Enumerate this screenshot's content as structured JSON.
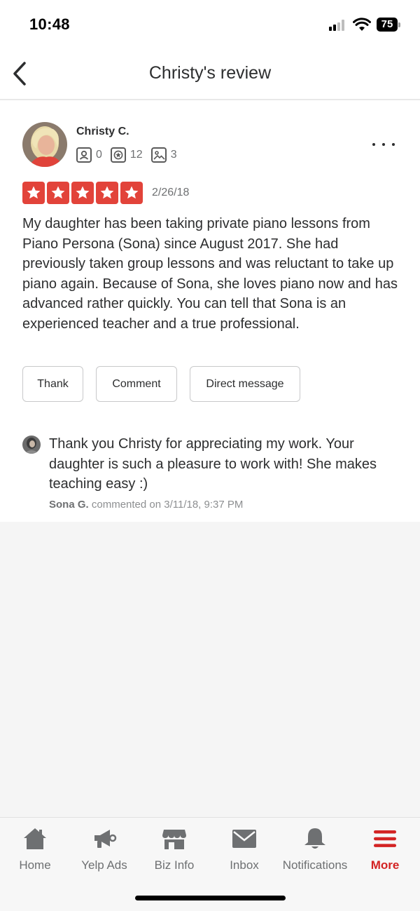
{
  "status_bar": {
    "time": "10:48",
    "battery": "75"
  },
  "header": {
    "title": "Christy's review",
    "back_icon": "chevron-left-icon"
  },
  "review": {
    "author": "Christy C.",
    "friends_count": "0",
    "reviews_count": "12",
    "photos_count": "3",
    "rating": 5,
    "date": "2/26/18",
    "text": "My daughter has been taking private piano lessons from Piano Persona (Sona) since August 2017.  She had previously taken group lessons and was reluctant to take up piano again.  Because of Sona, she loves piano now and has advanced rather quickly.  You can tell that Sona is an experienced teacher and a true professional.",
    "buttons": {
      "thank": "Thank",
      "comment": "Comment",
      "direct_message": "Direct message"
    }
  },
  "comment": {
    "text": "Thank you Christy for appreciating my work. Your daughter is such a pleasure to work with! She makes teaching easy :)",
    "author": "Sona G.",
    "meta": " commented on 3/11/18, 9:37 PM"
  },
  "tabs": [
    {
      "label": "Home",
      "icon": "home-icon"
    },
    {
      "label": "Yelp Ads",
      "icon": "megaphone-icon"
    },
    {
      "label": "Biz Info",
      "icon": "storefront-icon"
    },
    {
      "label": "Inbox",
      "icon": "mail-icon"
    },
    {
      "label": "Notifications",
      "icon": "bell-icon"
    },
    {
      "label": "More",
      "icon": "menu-icon",
      "active": true
    }
  ],
  "colors": {
    "star_red": "#e2433a",
    "active_tab": "#d32323",
    "text": "#2d2e2f",
    "muted": "#6e7072"
  }
}
